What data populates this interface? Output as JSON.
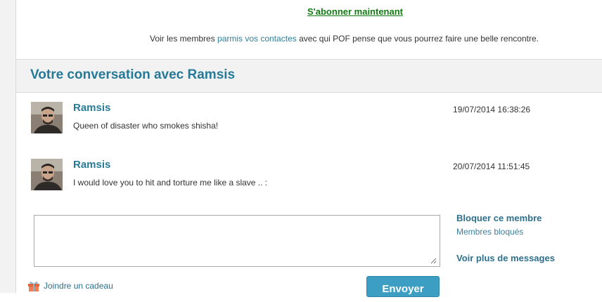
{
  "promo": {
    "subscribe_link": "S'abonner maintenant",
    "members_text_before": "Voir les membres ",
    "members_link": "parmis vos contactes",
    "members_text_after": " avec qui POF pense que vous pourrez faire une belle rencontre."
  },
  "conversation": {
    "title": "Votre conversation avec Ramsis",
    "messages": [
      {
        "sender": "Ramsis",
        "date": "19/07/2014 16:38:26",
        "text": "Queen of disaster who smokes shisha!"
      },
      {
        "sender": "Ramsis",
        "date": "20/07/2014 11:51:45",
        "text": "I would love you to hit and torture me like a slave .. :"
      }
    ]
  },
  "reply": {
    "value": "",
    "placeholder": ""
  },
  "sidebar": {
    "block_member": "Bloquer ce membre",
    "blocked_members": "Membres bloqués",
    "more_messages": "Voir plus de messages"
  },
  "gift": {
    "label": "Joindre un cadeau",
    "icon": "gift-icon"
  },
  "send_button": {
    "label": "Envoyer"
  },
  "colors": {
    "accent": "#277a97",
    "subscribe": "#117a11",
    "button": "#3c9ec2"
  }
}
